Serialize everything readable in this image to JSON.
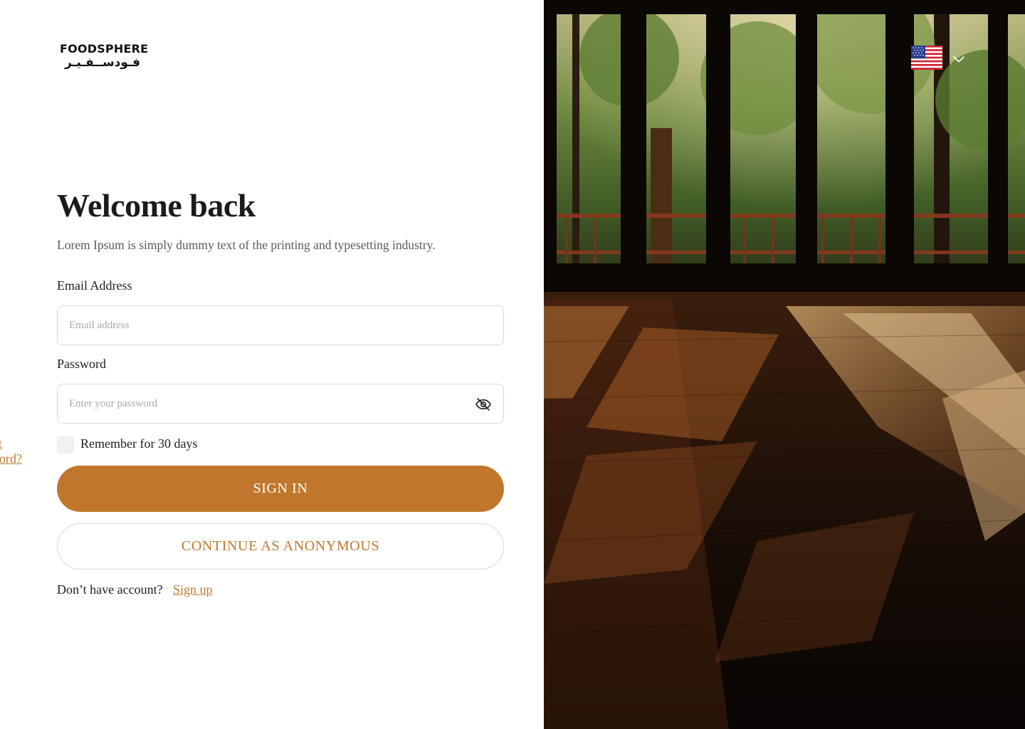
{
  "logo": {
    "name_en": "FOODSPHERE",
    "name_ar": "فـودســفـيـر"
  },
  "header": {
    "title": "Welcome back",
    "subtitle": "Lorem Ipsum is simply dummy text of the printing and typesetting industry."
  },
  "form": {
    "email_label": "Email Address",
    "email_placeholder": "Email address",
    "email_value": "",
    "password_label": "Password",
    "password_placeholder": "Enter your password",
    "password_value": "",
    "remember_label": "Remember for 30 days",
    "remember_checked": false,
    "forgot_label": "Forgot password?",
    "sign_in_label": "SIGN IN",
    "anonymous_label": "CONTINUE AS ANONYMOUS",
    "no_account_text": "Don’t have account?",
    "sign_up_label": "Sign up"
  },
  "language": {
    "selected_flag": "us-flag-icon"
  },
  "icons": {
    "password_toggle": "eye-off-icon",
    "dropdown": "chevron-down-icon"
  },
  "colors": {
    "accent": "#c0772c",
    "text": "#1d1d1f",
    "muted": "#5a5a5f",
    "border": "#d9d9dc"
  }
}
